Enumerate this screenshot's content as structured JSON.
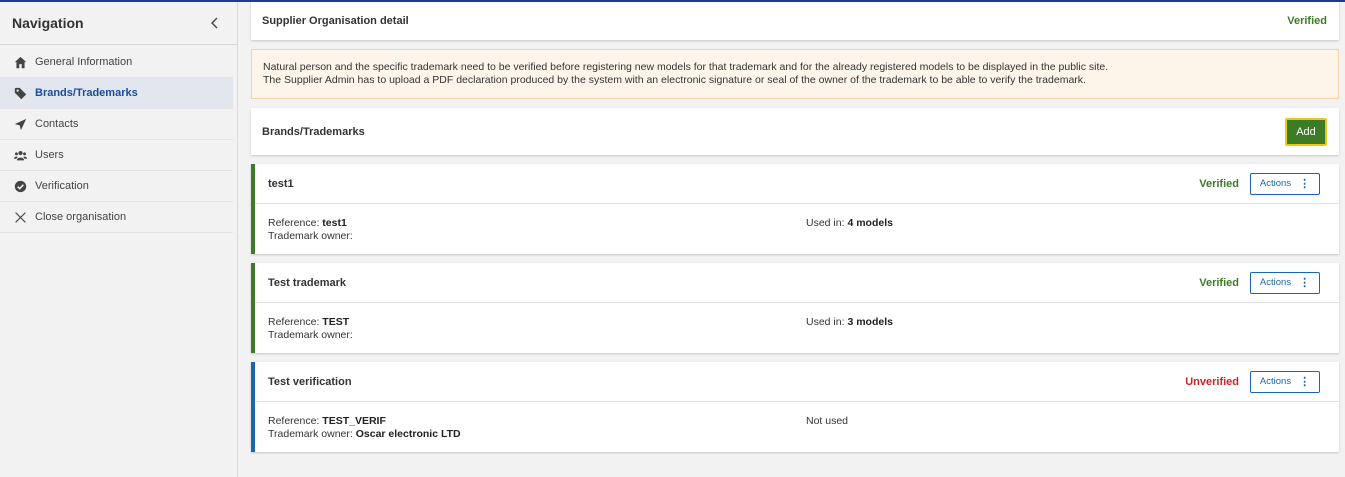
{
  "sidebar": {
    "title": "Navigation",
    "items": [
      {
        "label": "General Information",
        "icon": "home-icon",
        "active": false
      },
      {
        "label": "Brands/Trademarks",
        "icon": "tag-icon",
        "active": true
      },
      {
        "label": "Contacts",
        "icon": "paper-plane-icon",
        "active": false
      },
      {
        "label": "Users",
        "icon": "users-icon",
        "active": false
      },
      {
        "label": "Verification",
        "icon": "check-circle-icon",
        "active": false
      },
      {
        "label": "Close organisation",
        "icon": "close-icon",
        "active": false
      }
    ]
  },
  "header": {
    "title": "Supplier Organisation detail",
    "status": "Verified"
  },
  "notice": {
    "line1": "Natural person and the specific trademark need to be verified before registering new models for that trademark and for the already registered models to be displayed in the public site.",
    "line2": "The Supplier Admin has to upload a PDF declaration produced by the system with an electronic signature or seal of the owner of the trademark to be able to verify the trademark."
  },
  "section": {
    "title": "Brands/Trademarks",
    "add_label": "Add"
  },
  "trademarks": [
    {
      "name": "test1",
      "status": "Verified",
      "actions_label": "Actions",
      "reference_label": "Reference: ",
      "reference": "test1",
      "owner_label": "Trademark owner:",
      "owner": "",
      "used_label": "Used in: ",
      "used_value": "4 models"
    },
    {
      "name": "Test trademark",
      "status": "Verified",
      "actions_label": "Actions",
      "reference_label": "Reference: ",
      "reference": "TEST",
      "owner_label": "Trademark owner:",
      "owner": "",
      "used_label": "Used in: ",
      "used_value": "3 models"
    },
    {
      "name": "Test verification",
      "status": "Unverified",
      "actions_label": "Actions",
      "reference_label": "Reference: ",
      "reference": "TEST_VERIF",
      "owner_label": "Trademark owner: ",
      "owner": "Oscar electronic LTD",
      "used_label": "Not used",
      "used_value": ""
    }
  ],
  "colors": {
    "verified": "#3e7b26",
    "unverified": "#d32027",
    "accent": "#1a66b0",
    "nav_active": "#1a4c9b"
  }
}
